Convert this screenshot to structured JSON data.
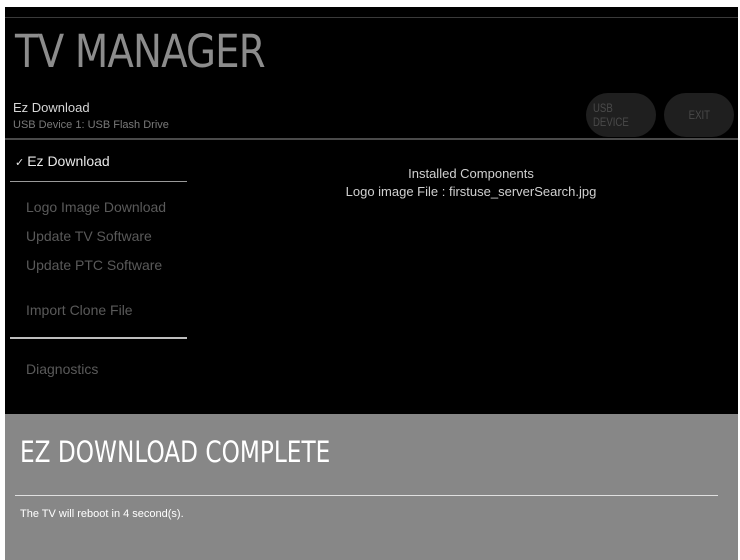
{
  "header": {
    "title": "TV MANAGER",
    "subtitle": "Ez Download",
    "device": "USB Device 1: USB Flash Drive",
    "buttons": {
      "usb_device": "USB DEVICE",
      "exit": "EXIT"
    }
  },
  "menu": {
    "active_check": "✓",
    "active": "Ez Download",
    "items": [
      "Logo Image Download",
      "Update TV Software",
      "Update PTC Software",
      "Import Clone File",
      "Diagnostics"
    ]
  },
  "content": {
    "heading": "Installed Components",
    "line": "Logo image File : firstuse_serverSearch.jpg"
  },
  "banner": {
    "title": "EZ DOWNLOAD COMPLETE",
    "message": "The TV will reboot in 4 second(s)."
  },
  "colors": {
    "background": "#000000",
    "banner": "#878787",
    "title_text": "#8c8c8c",
    "active_text": "#e8e8e8",
    "inactive_text": "#5a5a5a"
  }
}
